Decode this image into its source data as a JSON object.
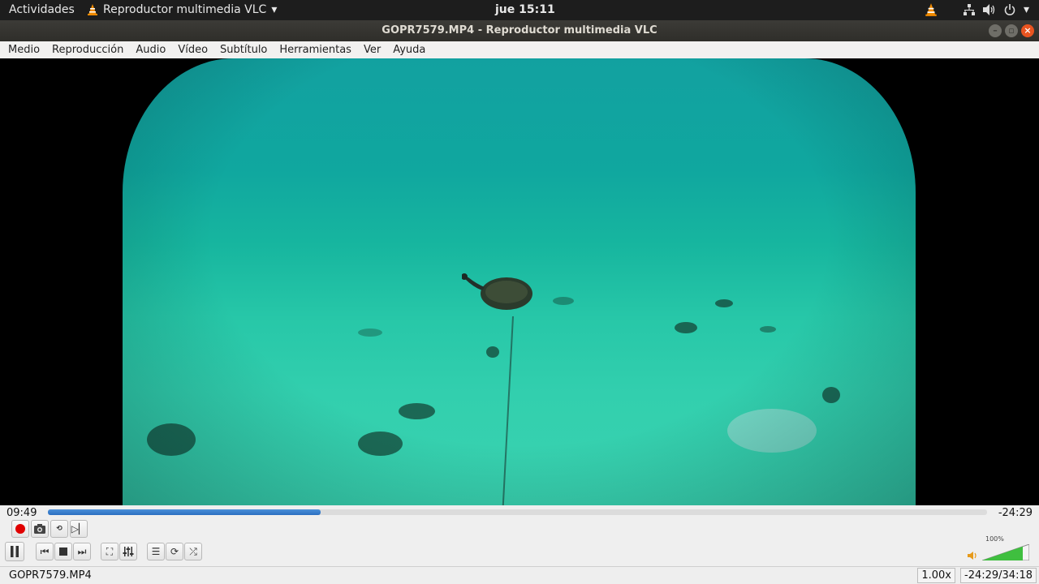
{
  "system_bar": {
    "activities": "Actividades",
    "app_name": "Reproductor multimedia VLC",
    "clock": "jue 15:11"
  },
  "window": {
    "title": "GOPR7579.MP4 - Reproductor multimedia VLC"
  },
  "menu": [
    {
      "label": "Medio"
    },
    {
      "label": "Reproducción"
    },
    {
      "label": "Audio"
    },
    {
      "label": "Vídeo"
    },
    {
      "label": "Subtítulo"
    },
    {
      "label": "Herramientas"
    },
    {
      "label": "Ver"
    },
    {
      "label": "Ayuda"
    }
  ],
  "playback": {
    "elapsed": "09:49",
    "remaining": "-24:29",
    "progress_fraction": 0.29
  },
  "status": {
    "file_name": "GOPR7579.MP4",
    "speed": "1.00x",
    "time_total": "-24:29/34:18",
    "volume_label": "100%"
  },
  "colors": {
    "accent": "#2c6fc0",
    "record": "#e00000",
    "close_button": "#e95420",
    "vlc_orange": "#f08a00"
  }
}
